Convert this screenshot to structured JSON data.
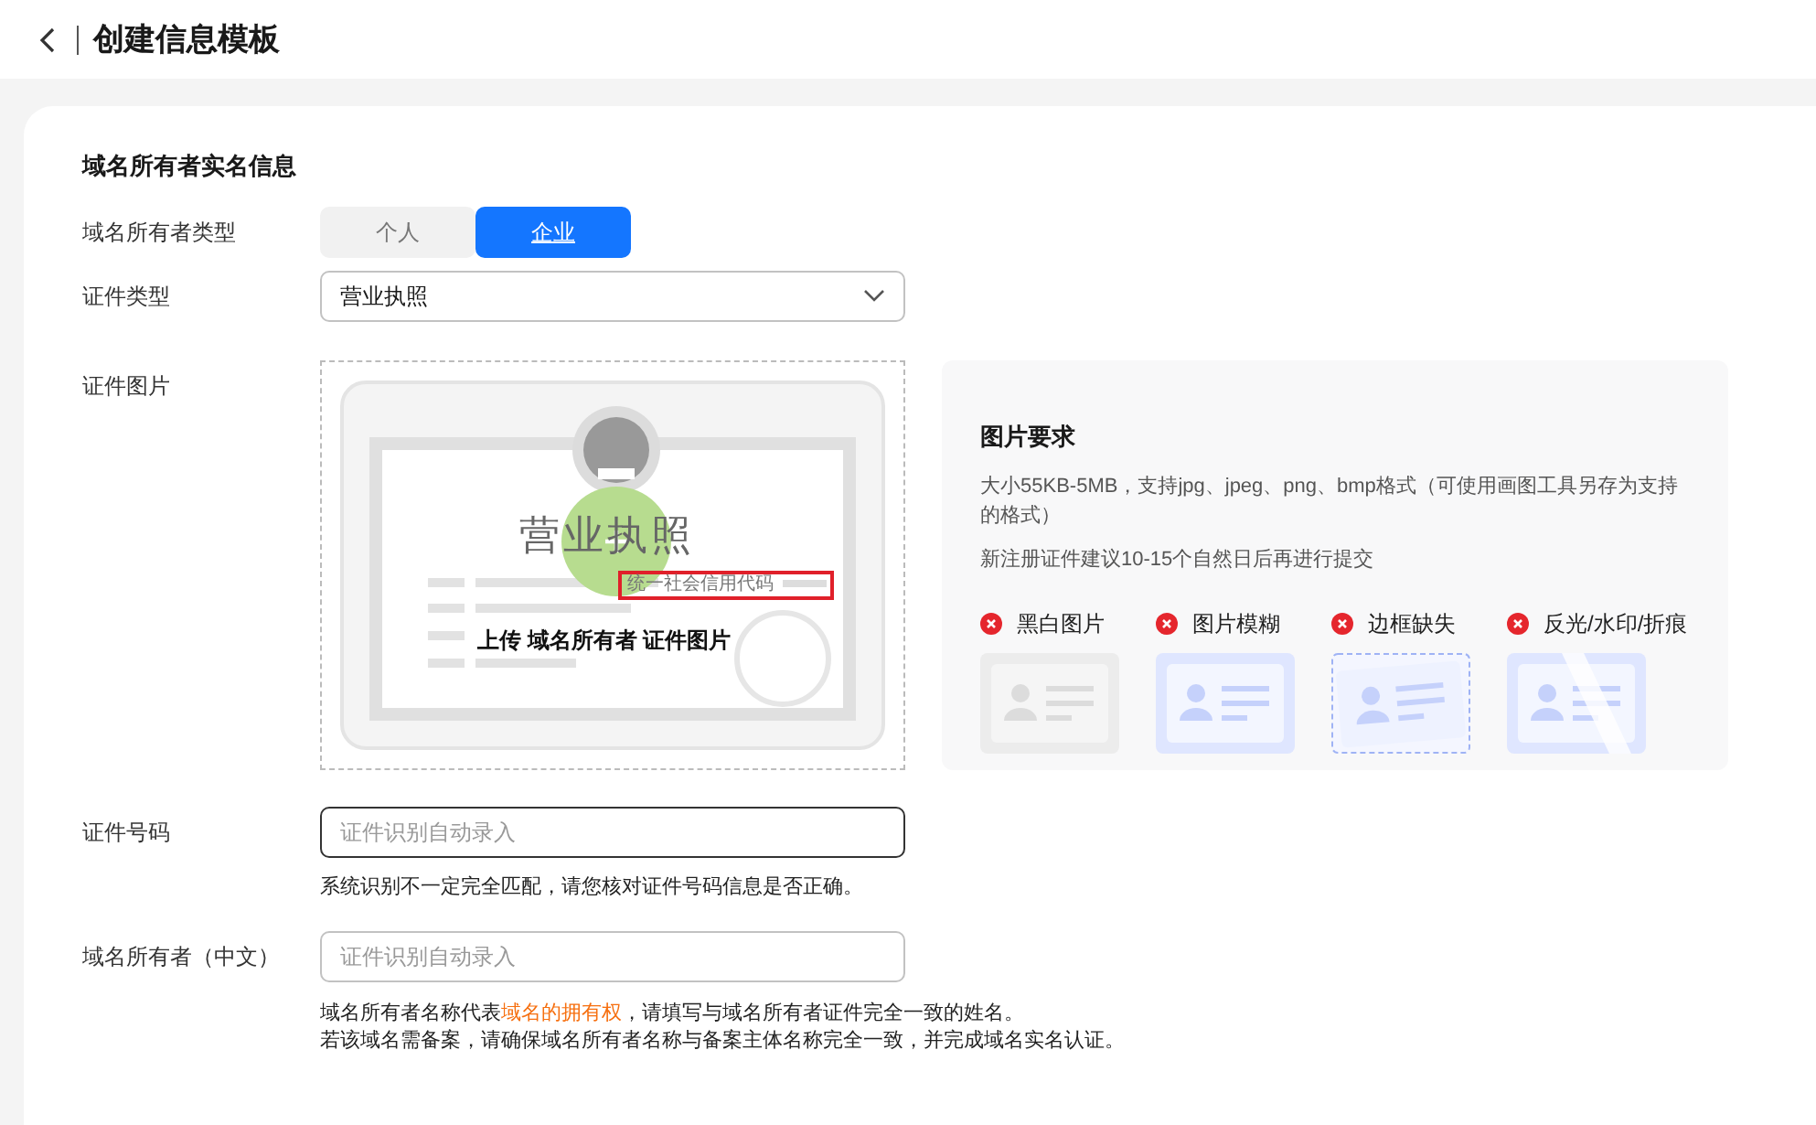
{
  "header": {
    "title": "创建信息模板"
  },
  "section_title": "域名所有者实名信息",
  "owner_type": {
    "label": "域名所有者类型",
    "options": [
      {
        "label": "个人",
        "selected": false
      },
      {
        "label": "企业",
        "selected": true
      }
    ]
  },
  "cert_type": {
    "label": "证件类型",
    "value": "营业执照"
  },
  "cert_image": {
    "label": "证件图片",
    "sample_title": "营业执照",
    "sample_code_label": "统一社会信用代码",
    "upload_label": "上传 域名所有者 证件图片"
  },
  "requirements": {
    "title": "图片要求",
    "lines": [
      "大小55KB-5MB，支持jpg、jpeg、png、bmp格式（可使用画图工具另存为支持的格式）",
      "新注册证件建议10-15个自然日后再进行提交"
    ],
    "examples": [
      {
        "label": "黑白图片",
        "kind": "bw"
      },
      {
        "label": "图片模糊",
        "kind": "blurry"
      },
      {
        "label": "边框缺失",
        "kind": "cropped"
      },
      {
        "label": "反光/水印/折痕",
        "kind": "glare"
      }
    ]
  },
  "fields": [
    {
      "label": "证件号码",
      "placeholder": "证件识别自动录入",
      "focused": true,
      "hints": [
        [
          {
            "kind": "text",
            "text": "系统识别不一定完全匹配，请您核对证件号码信息是否正确。"
          }
        ]
      ]
    },
    {
      "label": "域名所有者（中文）",
      "placeholder": "证件识别自动录入",
      "focused": false,
      "hints": [
        [
          {
            "kind": "text",
            "text": "域名所有者名称代表"
          },
          {
            "kind": "link",
            "text": "域名的拥有权"
          },
          {
            "kind": "text",
            "text": "，请填写与域名所有者证件完全一致的姓名。"
          }
        ],
        [
          {
            "kind": "text",
            "text": "若该域名需备案，请确保域名所有者名称与备案主体名称完全一致，并完成域名实名认证。"
          }
        ]
      ]
    }
  ]
}
